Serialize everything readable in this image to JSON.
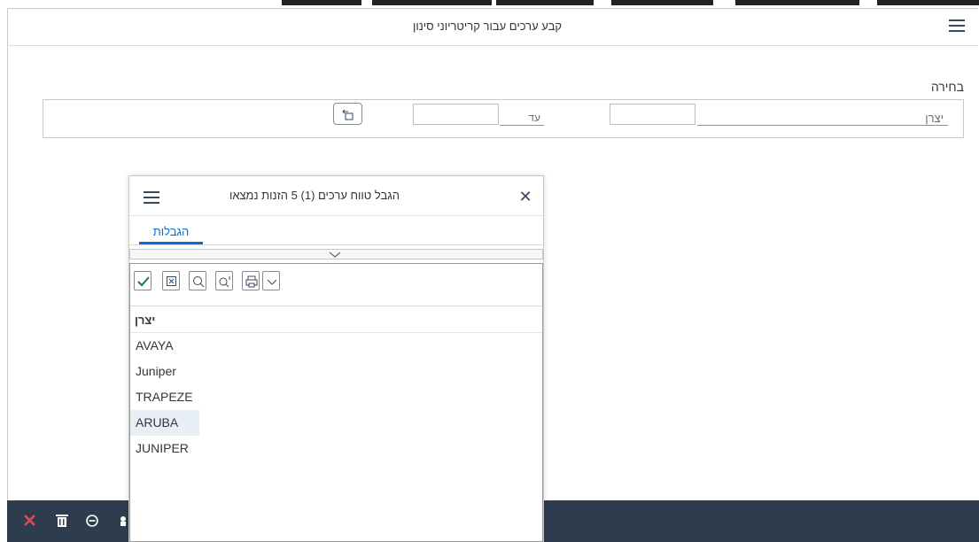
{
  "main_dialog": {
    "title": "קבע ערכים עבור קריטריוני סינון",
    "menu_icon": "hamburger-icon",
    "section_label": "בחירה",
    "filter": {
      "field_label": "יצרן",
      "from_value": "",
      "to_label": "עד",
      "to_value": "",
      "multi_select_icon": "multiple-selection-icon"
    }
  },
  "popup": {
    "title": "הגבל טווח ערכים (1)   5 הזנות נמצאו",
    "close_icon": "close-icon",
    "menu_icon": "hamburger-icon",
    "tab_label": "הגבלות",
    "collapse_icon": "chevron-down-icon",
    "toolbar": [
      {
        "icon": "checkmark-icon",
        "color": "#107e3e"
      },
      {
        "icon": "cancel-box-icon"
      },
      {
        "icon": "search-icon"
      },
      {
        "icon": "search-more-icon"
      },
      {
        "icon": "print-icon"
      },
      {
        "icon": "chevron-down-icon"
      }
    ],
    "column_header": "יצרן",
    "rows": [
      "AVAYA",
      "Juniper",
      "TRAPEZE",
      "ARUBA",
      "JUNIPER"
    ],
    "selected_row": "ARUBA"
  },
  "bottom_bar": {
    "icons": [
      {
        "icon": "delete-x-icon",
        "color": "#e5484d"
      },
      {
        "icon": "trash-icon",
        "color": "#ffffff"
      },
      {
        "icon": "minus-circle-icon",
        "color": "#ffffff"
      }
    ],
    "background": "#2e3d4d"
  },
  "colors": {
    "accent": "#0a6ed1",
    "text": "#32363a",
    "confirm": "#107e3e",
    "cancel": "#e5484d"
  }
}
